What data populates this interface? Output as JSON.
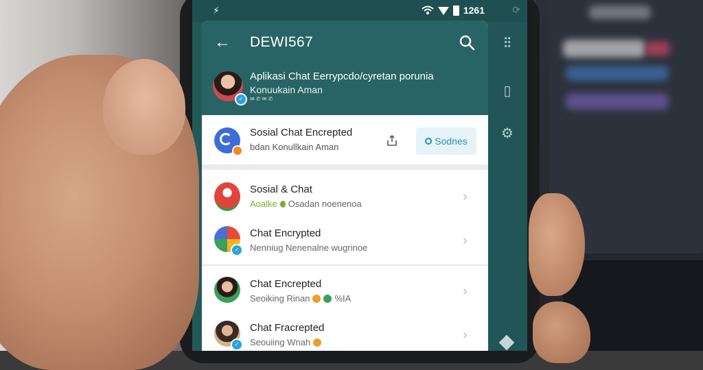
{
  "status_bar": {
    "left_glyph": "⚡",
    "time": "1261"
  },
  "header": {
    "title": "DEWI567"
  },
  "profile": {
    "line1": "Aplikasi Chat Eerrypcdo/cyretan porunia",
    "line2": "Konuukain Aman",
    "line3": "✉ ✆ ✉ ✆"
  },
  "card": {
    "title": "Sosial Chat Encrepted",
    "subtitle": "bdan Konullkain Aman",
    "button_label": "Sodnes"
  },
  "list": [
    {
      "title": "Sosial & Chat",
      "sub_green": "Aoalke",
      "sub_rest": "Osadan noenenoa",
      "avatar_color": "#e0443a"
    },
    {
      "title": "Chat Encrypted",
      "sub_rest": "Nenniug Nenenalne wugrinoe",
      "avatar_color": "#d04a7a"
    },
    {
      "title": "Chat Encrepted",
      "sub_rest": "Seoiking Rinan",
      "sub_after": "%IA",
      "avatar_color": "#3aa05a"
    },
    {
      "title": "Chat Fracrepted",
      "sub_rest": "Seouiing Wnah",
      "avatar_color": "#3a2a24"
    }
  ],
  "colors": {
    "header_teal": "#286466",
    "rail_teal": "#215557",
    "accent_blue": "#2aa3df",
    "button_text": "#2b90b0"
  }
}
